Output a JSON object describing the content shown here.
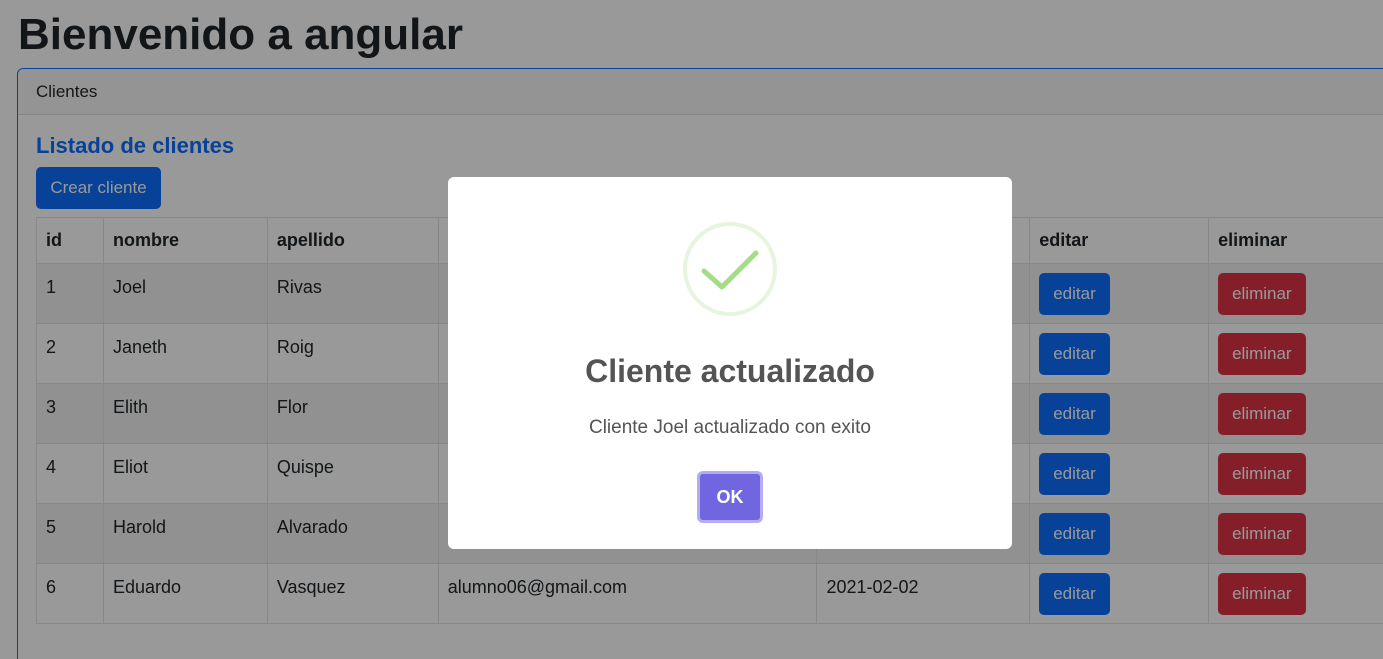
{
  "page": {
    "title": "Bienvenido a angular"
  },
  "card": {
    "header": "Clientes",
    "title": "Listado de clientes",
    "create_button": "Crear cliente"
  },
  "table": {
    "headers": [
      "id",
      "nombre",
      "apellido",
      "",
      "",
      "editar",
      "eliminar"
    ],
    "rows": [
      {
        "id": "1",
        "nombre": "Joel",
        "apellido": "Rivas",
        "email": "",
        "fecha": "",
        "editar": "editar",
        "eliminar": "eliminar"
      },
      {
        "id": "2",
        "nombre": "Janeth",
        "apellido": "Roig",
        "email": "",
        "fecha": "",
        "editar": "editar",
        "eliminar": "eliminar"
      },
      {
        "id": "3",
        "nombre": "Elith",
        "apellido": "Flor",
        "email": "",
        "fecha": "",
        "editar": "editar",
        "eliminar": "eliminar"
      },
      {
        "id": "4",
        "nombre": "Eliot",
        "apellido": "Quispe",
        "email": "",
        "fecha": "",
        "editar": "editar",
        "eliminar": "eliminar"
      },
      {
        "id": "5",
        "nombre": "Harold",
        "apellido": "Alvarado",
        "email": "",
        "fecha": "",
        "editar": "editar",
        "eliminar": "eliminar"
      },
      {
        "id": "6",
        "nombre": "Eduardo",
        "apellido": "Vasquez",
        "email": "alumno06@gmail.com",
        "fecha": "2021-02-02",
        "editar": "editar",
        "eliminar": "eliminar"
      }
    ]
  },
  "modal": {
    "icon": "success-check-icon",
    "title": "Cliente actualizado",
    "text": "Cliente Joel actualizado con exito",
    "ok_label": "OK"
  },
  "colors": {
    "primary": "#0d6efd",
    "danger": "#dc3545",
    "modal_confirm": "#7066e0",
    "success_icon": "#a5dc86"
  }
}
